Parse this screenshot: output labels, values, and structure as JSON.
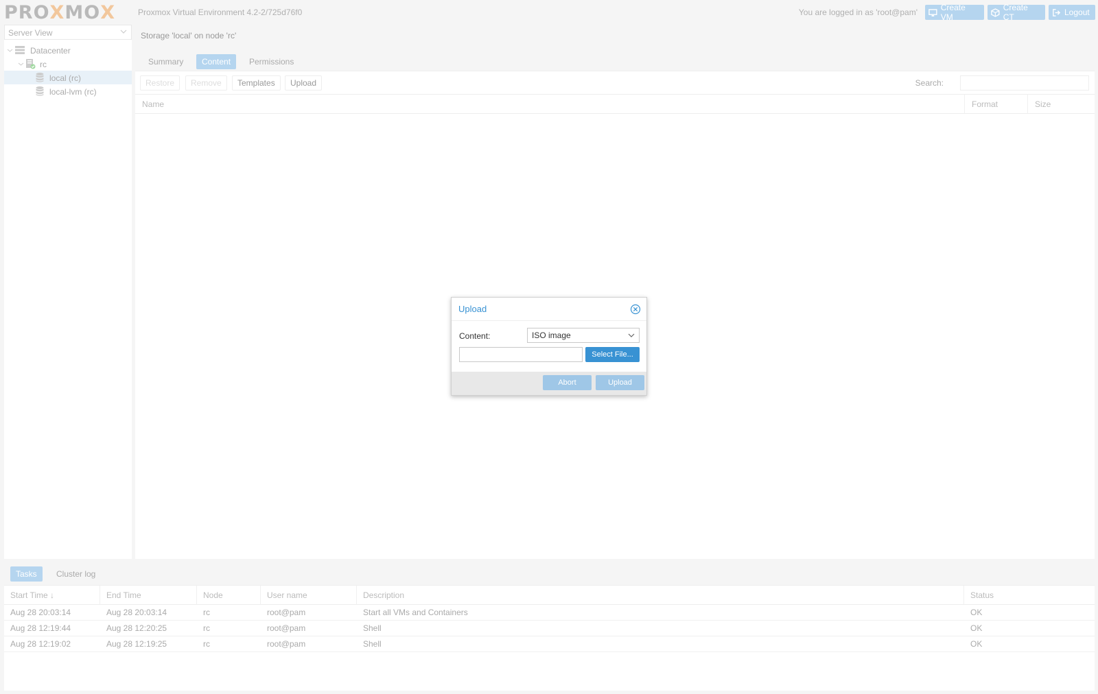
{
  "header": {
    "logo": {
      "part1": "PRO",
      "x": "X",
      "part2": "MO",
      "x2": "X"
    },
    "version": "Proxmox Virtual Environment 4.2-2/725d76f0",
    "logged_in": "You are logged in as 'root@pam'",
    "buttons": {
      "create_vm": "Create VM",
      "create_ct": "Create CT",
      "logout": "Logout"
    }
  },
  "sidebar": {
    "view": "Server View",
    "tree": [
      {
        "label": "Datacenter",
        "icon": "datacenter-icon"
      },
      {
        "label": "rc",
        "icon": "node-online-icon"
      },
      {
        "label": "local (rc)",
        "icon": "storage-icon",
        "selected": true
      },
      {
        "label": "local-lvm (rc)",
        "icon": "storage-icon"
      }
    ]
  },
  "main": {
    "title": "Storage 'local' on node 'rc'",
    "tabs": [
      "Summary",
      "Content",
      "Permissions"
    ],
    "active_tab": "Content",
    "toolbar": {
      "restore": "Restore",
      "remove": "Remove",
      "templates": "Templates",
      "upload": "Upload",
      "search_label": "Search:"
    },
    "columns": [
      "Name",
      "Format",
      "Size"
    ]
  },
  "dialog": {
    "title": "Upload",
    "content_label": "Content:",
    "content_value": "ISO image",
    "file_value": "",
    "select_file": "Select File...",
    "abort": "Abort",
    "upload": "Upload"
  },
  "log": {
    "tabs": [
      "Tasks",
      "Cluster log"
    ],
    "active_tab": "Tasks",
    "columns": [
      "Start Time",
      "End Time",
      "Node",
      "User name",
      "Description",
      "Status"
    ],
    "sort_indicator": "↓",
    "rows": [
      {
        "start": "Aug 28 20:03:14",
        "end": "Aug 28 20:03:14",
        "node": "rc",
        "user": "root@pam",
        "desc": "Start all VMs and Containers",
        "status": "OK"
      },
      {
        "start": "Aug 28 12:19:44",
        "end": "Aug 28 12:20:25",
        "node": "rc",
        "user": "root@pam",
        "desc": "Shell",
        "status": "OK"
      },
      {
        "start": "Aug 28 12:19:02",
        "end": "Aug 28 12:19:25",
        "node": "rc",
        "user": "root@pam",
        "desc": "Shell",
        "status": "OK"
      }
    ]
  },
  "colors": {
    "accent": "#3892d3",
    "accent_faded": "#b5d5ef",
    "logo_x": "#f2c79c"
  }
}
